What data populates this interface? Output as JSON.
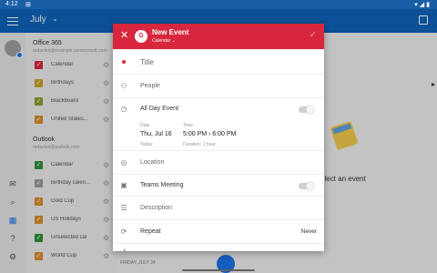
{
  "statusbar": {
    "time": "4:12"
  },
  "appbar": {
    "month": "July"
  },
  "office365": {
    "title": "Office 365",
    "account": "redacted@example.onmicrosoft.com",
    "calendars": [
      {
        "label": "Calendar",
        "color": "#d7263d"
      },
      {
        "label": "Birthdays",
        "color": "#c9a227"
      },
      {
        "label": "Blackboard",
        "color": "#8a9b2a"
      },
      {
        "label": "United States...",
        "color": "#d98a2b"
      }
    ]
  },
  "outlook": {
    "title": "Outlook",
    "account": "redacted@outlook.com",
    "calendars": [
      {
        "label": "Calendar",
        "color": "#2f8f3a"
      },
      {
        "label": "Birthday calen...",
        "color": "#9a9a9a"
      },
      {
        "label": "Gold Cup",
        "color": "#d98a2b"
      },
      {
        "label": "US Holidays",
        "color": "#d98a2b"
      },
      {
        "label": "Unselected cal",
        "color": "#2f8f3a"
      },
      {
        "label": "World Cup",
        "color": "#d98a2b"
      }
    ]
  },
  "background": {
    "select_text": "elect an event",
    "day_label": "FRIDAY, JULY 24"
  },
  "dialog": {
    "title": "New Event",
    "subtitle": "Calendar",
    "badge": "G",
    "fields": {
      "title_placeholder": "Title",
      "people": "People",
      "all_day": "All Day Event",
      "date_label": "Date",
      "date_value": "Thu, Jul 16",
      "date_sub": "Today",
      "time_label": "Time",
      "time_value": "5:00 PM › 6:00 PM",
      "time_sub": "Duration: 1 hour",
      "location": "Location",
      "teams": "Teams Meeting",
      "description": "Description",
      "repeat": "Repeat",
      "repeat_value": "Never"
    },
    "accent_color": "#d7263d"
  }
}
